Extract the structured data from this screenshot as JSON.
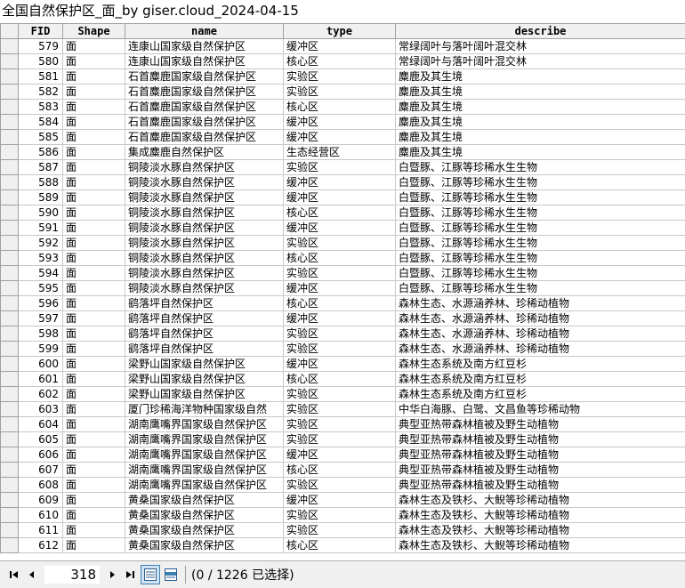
{
  "window": {
    "title": "全国自然保护区_面_by giser.cloud_2024-04-15"
  },
  "table": {
    "columns": [
      "FID",
      "Shape",
      "name",
      "type",
      "describe"
    ],
    "rows": [
      [
        "579",
        "面",
        "连康山国家级自然保护区",
        "缓冲区",
        "常绿阔叶与落叶阔叶混交林"
      ],
      [
        "580",
        "面",
        "连康山国家级自然保护区",
        "核心区",
        "常绿阔叶与落叶阔叶混交林"
      ],
      [
        "581",
        "面",
        "石首麋鹿国家级自然保护区",
        "实验区",
        "麋鹿及其生境"
      ],
      [
        "582",
        "面",
        "石首麋鹿国家级自然保护区",
        "实验区",
        "麋鹿及其生境"
      ],
      [
        "583",
        "面",
        "石首麋鹿国家级自然保护区",
        "核心区",
        "麋鹿及其生境"
      ],
      [
        "584",
        "面",
        "石首麋鹿国家级自然保护区",
        "缓冲区",
        "麋鹿及其生境"
      ],
      [
        "585",
        "面",
        "石首麋鹿国家级自然保护区",
        "缓冲区",
        "麋鹿及其生境"
      ],
      [
        "586",
        "面",
        "集成麋鹿自然保护区",
        "生态经营区",
        "麋鹿及其生境"
      ],
      [
        "587",
        "面",
        "铜陵淡水豚自然保护区",
        "实验区",
        "白暨豚、江豚等珍稀水生生物"
      ],
      [
        "588",
        "面",
        "铜陵淡水豚自然保护区",
        "缓冲区",
        "白暨豚、江豚等珍稀水生生物"
      ],
      [
        "589",
        "面",
        "铜陵淡水豚自然保护区",
        "缓冲区",
        "白暨豚、江豚等珍稀水生生物"
      ],
      [
        "590",
        "面",
        "铜陵淡水豚自然保护区",
        "核心区",
        "白暨豚、江豚等珍稀水生生物"
      ],
      [
        "591",
        "面",
        "铜陵淡水豚自然保护区",
        "缓冲区",
        "白暨豚、江豚等珍稀水生生物"
      ],
      [
        "592",
        "面",
        "铜陵淡水豚自然保护区",
        "实验区",
        "白暨豚、江豚等珍稀水生生物"
      ],
      [
        "593",
        "面",
        "铜陵淡水豚自然保护区",
        "核心区",
        "白暨豚、江豚等珍稀水生生物"
      ],
      [
        "594",
        "面",
        "铜陵淡水豚自然保护区",
        "实验区",
        "白暨豚、江豚等珍稀水生生物"
      ],
      [
        "595",
        "面",
        "铜陵淡水豚自然保护区",
        "缓冲区",
        "白暨豚、江豚等珍稀水生生物"
      ],
      [
        "596",
        "面",
        "鹞落坪自然保护区",
        "核心区",
        "森林生态、水源涵养林、珍稀动植物"
      ],
      [
        "597",
        "面",
        "鹞落坪自然保护区",
        "缓冲区",
        "森林生态、水源涵养林、珍稀动植物"
      ],
      [
        "598",
        "面",
        "鹞落坪自然保护区",
        "实验区",
        "森林生态、水源涵养林、珍稀动植物"
      ],
      [
        "599",
        "面",
        "鹞落坪自然保护区",
        "实验区",
        "森林生态、水源涵养林、珍稀动植物"
      ],
      [
        "600",
        "面",
        "梁野山国家级自然保护区",
        "缓冲区",
        "森林生态系统及南方红豆杉"
      ],
      [
        "601",
        "面",
        "梁野山国家级自然保护区",
        "核心区",
        "森林生态系统及南方红豆杉"
      ],
      [
        "602",
        "面",
        "梁野山国家级自然保护区",
        "实验区",
        "森林生态系统及南方红豆杉"
      ],
      [
        "603",
        "面",
        "厦门珍稀海洋物种国家级自然",
        "实验区",
        "中华白海豚、白鹭、文昌鱼等珍稀动物"
      ],
      [
        "604",
        "面",
        "湖南鹰嘴界国家级自然保护区",
        "实验区",
        "典型亚热带森林植被及野生动植物"
      ],
      [
        "605",
        "面",
        "湖南鹰嘴界国家级自然保护区",
        "实验区",
        "典型亚热带森林植被及野生动植物"
      ],
      [
        "606",
        "面",
        "湖南鹰嘴界国家级自然保护区",
        "缓冲区",
        "典型亚热带森林植被及野生动植物"
      ],
      [
        "607",
        "面",
        "湖南鹰嘴界国家级自然保护区",
        "核心区",
        "典型亚热带森林植被及野生动植物"
      ],
      [
        "608",
        "面",
        "湖南鹰嘴界国家级自然保护区",
        "实验区",
        "典型亚热带森林植被及野生动植物"
      ],
      [
        "609",
        "面",
        "黄桑国家级自然保护区",
        "缓冲区",
        "森林生态及铁杉、大鲵等珍稀动植物"
      ],
      [
        "610",
        "面",
        "黄桑国家级自然保护区",
        "实验区",
        "森林生态及铁杉、大鲵等珍稀动植物"
      ],
      [
        "611",
        "面",
        "黄桑国家级自然保护区",
        "实验区",
        "森林生态及铁杉、大鲵等珍稀动植物"
      ],
      [
        "612",
        "面",
        "黄桑国家级自然保护区",
        "核心区",
        "森林生态及铁杉、大鲵等珍稀动植物"
      ]
    ]
  },
  "statusbar": {
    "first_icon": "first-record-icon",
    "prev_icon": "previous-record-icon",
    "next_icon": "next-record-icon",
    "last_icon": "last-record-icon",
    "current_record": "318",
    "show_all_icon": "show-all-records-icon",
    "show_selected_icon": "show-selected-records-icon",
    "selection_status": "(0 / 1226 已选择)"
  }
}
